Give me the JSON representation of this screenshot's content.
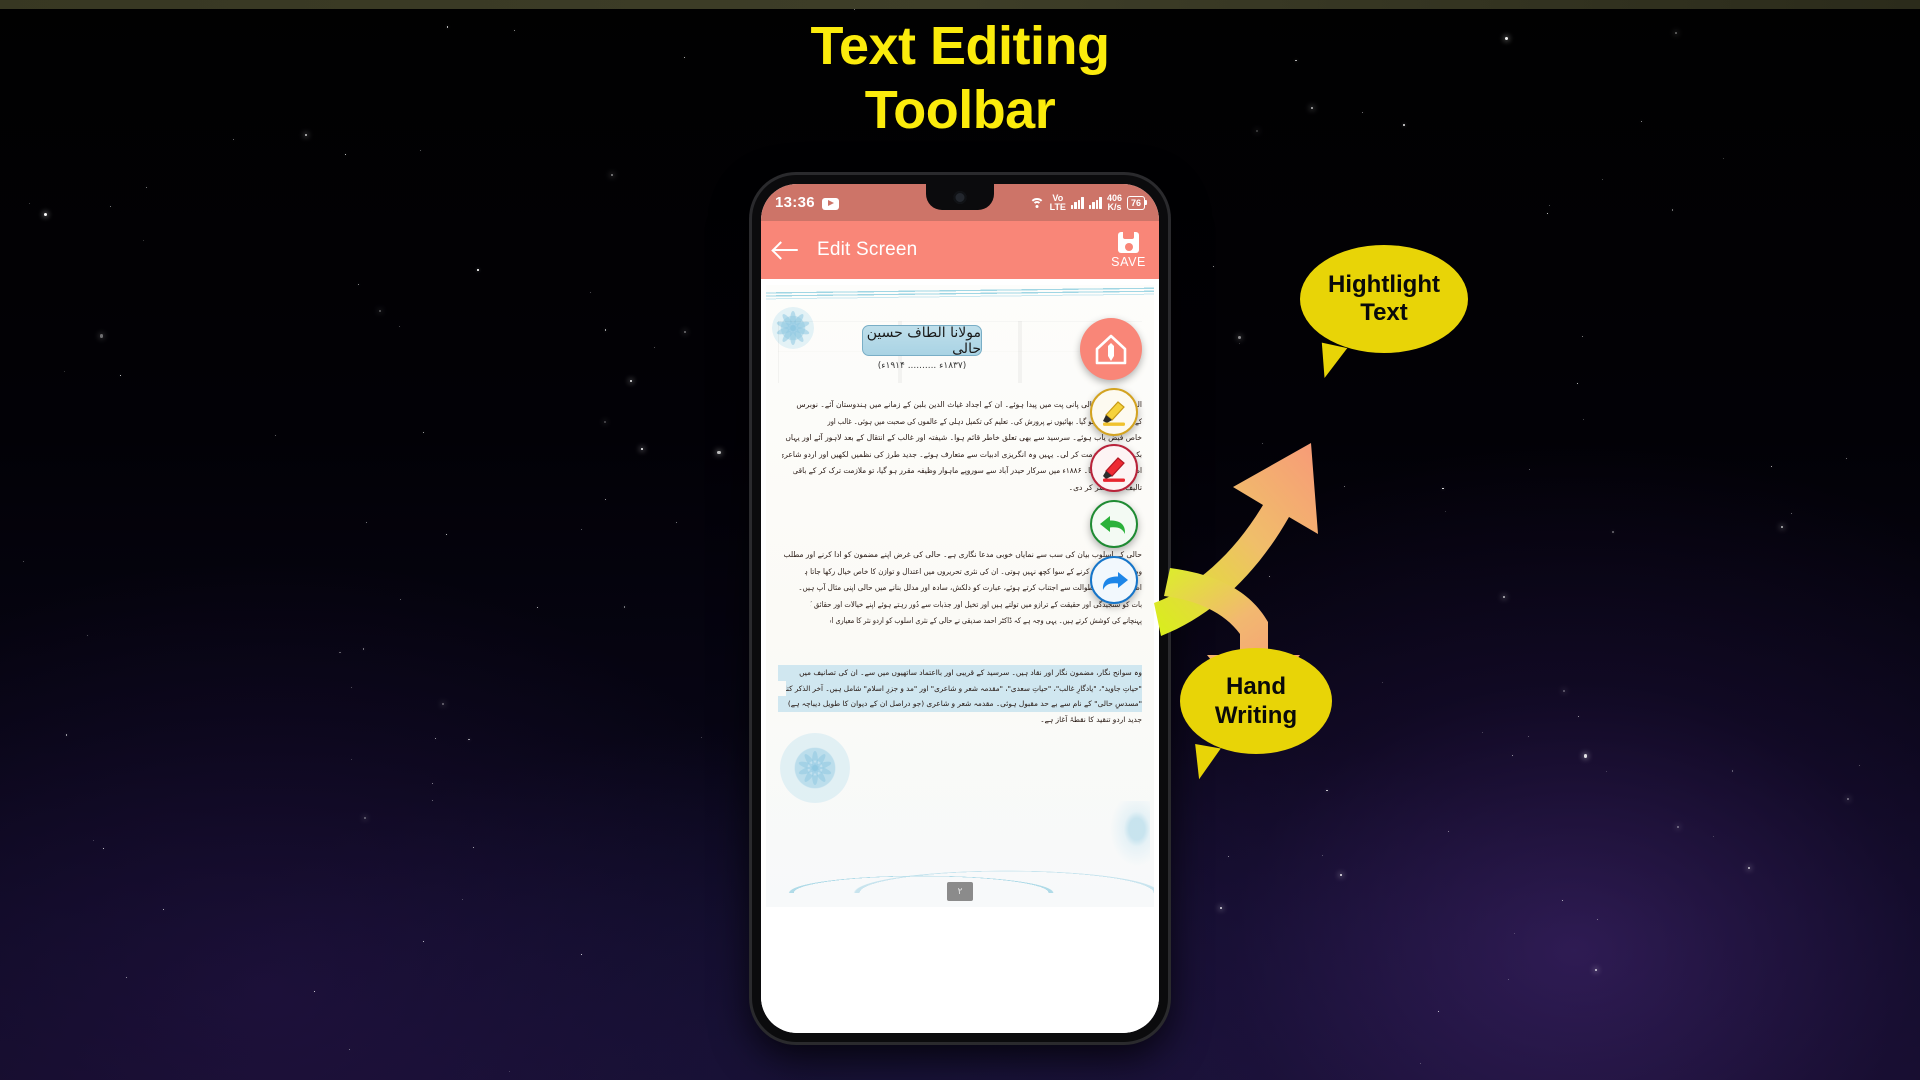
{
  "headline": {
    "line1": "Text Editing",
    "line2": "Toolbar",
    "color": "#FBEB0C"
  },
  "phone": {
    "status_bar": {
      "time": "13:36",
      "youtube_icon": "youtube-icon",
      "wifi_icon": "wifi-icon",
      "volte_label": "Vo\nLTE",
      "volte_line1": "Vo",
      "volte_line2": "LTE",
      "signal_icon": "signal-bars-icon",
      "data_rate_value": "406",
      "data_rate_unit": "K/s",
      "battery_level": "76",
      "background_color": "#cd7468"
    },
    "app_bar": {
      "back_icon": "back-arrow-icon",
      "title": "Edit Screen",
      "save_icon": "floppy-disk-icon",
      "save_label": "SAVE",
      "background_color": "#F98678"
    },
    "document": {
      "heading": "مولانا الطاف حسین حالی",
      "dates": "(۱۸۳۷ء .......... ۱۹۱۴ء)",
      "page_number": "۲",
      "paragraph1": [
        "الطاف حسین حالی پانی پت میں پیدا ہوئے۔ ان کے اجداد غیاث الدین بلبن کے زمانے میں ہندوستان آئے۔ نوبرس",
        "کے والد کا انتقال ہو گیا۔ بھائیوں نے پرورش کی۔ تعلیم کی تکمیل دہلی کے عالموں کی صحبت میں ہوئی۔ غالب اور شیفتہ کی صحبت",
        "خاص فیض یاب ہوئے۔ سرسید سے بھی تعلق خاطر قائم ہوا۔ شیفتہ اور غالب کے انتقال کے بعد لاہور آئے اور یہاں",
        "بک ڈپو میں ملازمت کر لی۔ یہیں وہ انگریزی ادبیات سے متعارف ہوئے۔ جدید طرز کی نظمیں لکھیں اور اردو شاعری",
        "اصلاح کا بیڑا اٹھایا۔ ۱۸۸۶ء میں سرکار حیدر آباد سے سوروپے ماہوار وظیفہ مقرر ہو گیا، تو ملازمت ترک کر کے باقی عمر",
        "تالیف میں بسر کر دی۔"
      ],
      "paragraph2": [
        "حالی کے اسلوب بیان کی سب سے نمایاں خوبی مدعا نگاری ہے۔ حالی کی غرض اپنے مضمون کو ادا کرنے اور مطلب و",
        "وضاحت سے پیش کرنے کے سوا کچھ نہیں ہوتی۔ ان کی نثری تحریروں میں اعتدال و توازن کا خاص خیال رکھا جاتا ہے۔ بے جا",
        "اظہار اور بے جا طوالت سے اجتناب کرتے ہوئے، عبارت کو دلکش، سادہ اور مدلل بنانے میں حالی اپنی مثال آپ ہیں۔ وہ ہر",
        "بات کو سنجیدگی اور حقیقت کے ترازو میں تولتے ہیں اور تخیل اور جذبات سے دُور رہتے ہوئے اپنے خیالات اور حقائق کو قاری تک",
        "پہنچانے کی کوشش کرتے ہیں۔ یہی وجہ ہے کہ ڈاکٹر احمد صدیقی نے حالی کے نثری اسلوب کو اردو نثر کا معیاری اسلوب قرار دیا ہے۔"
      ],
      "paragraph3": [
        "وہ سوانح نگار، مضمون نگار اور نقاد ہیں۔ سرسید کے قریبی اور بااعتماد ساتھیوں میں سے۔ ان کی تصانیف میں",
        "\"حیاتِ جاوید\"، \"یادگارِ غالب\"، \"حیاتِ سعدی\"، \"مقدمہ شعر و شاعری\" اور \"مد و جزرِ اسلام\" شامل ہیں۔ آخر الذکر کتاب",
        "\"مسدسِ حالی\" کے نام سے بے حد مقبول ہوئی۔ مقدمہ شعر و شاعری (جو دراصل ان کے دیوان کا طویل دیباچہ ہے)",
        "جدید اردو تنقید کا نقطۂ آغاز ہے۔"
      ]
    },
    "toolbar": [
      {
        "name": "edit-text-fab",
        "label": "Edit Text",
        "icon": "pencil-in-home-icon",
        "color": "#F98678"
      },
      {
        "name": "highlight-tool",
        "label": "Highlight",
        "icon": "highlighter-icon",
        "color": "#d3a321"
      },
      {
        "name": "pen-tool",
        "label": "Hand Writing",
        "icon": "red-marker-icon",
        "color": "#b8233a"
      },
      {
        "name": "undo-tool",
        "label": "Undo",
        "icon": "undo-arrow-icon",
        "color": "#1f8b33"
      },
      {
        "name": "redo-tool",
        "label": "Redo",
        "icon": "redo-arrow-icon",
        "color": "#1675c9"
      }
    ]
  },
  "callouts": [
    {
      "name": "highlight-callout",
      "line1": "Hightlight",
      "line2": "Text",
      "color": "#E8D407"
    },
    {
      "name": "handwriting-callout",
      "line1": "Hand",
      "line2": "Writing",
      "color": "#E8D407"
    }
  ],
  "arrows": {
    "gradient_from": "#D8F019",
    "gradient_to": "#F79A78"
  }
}
